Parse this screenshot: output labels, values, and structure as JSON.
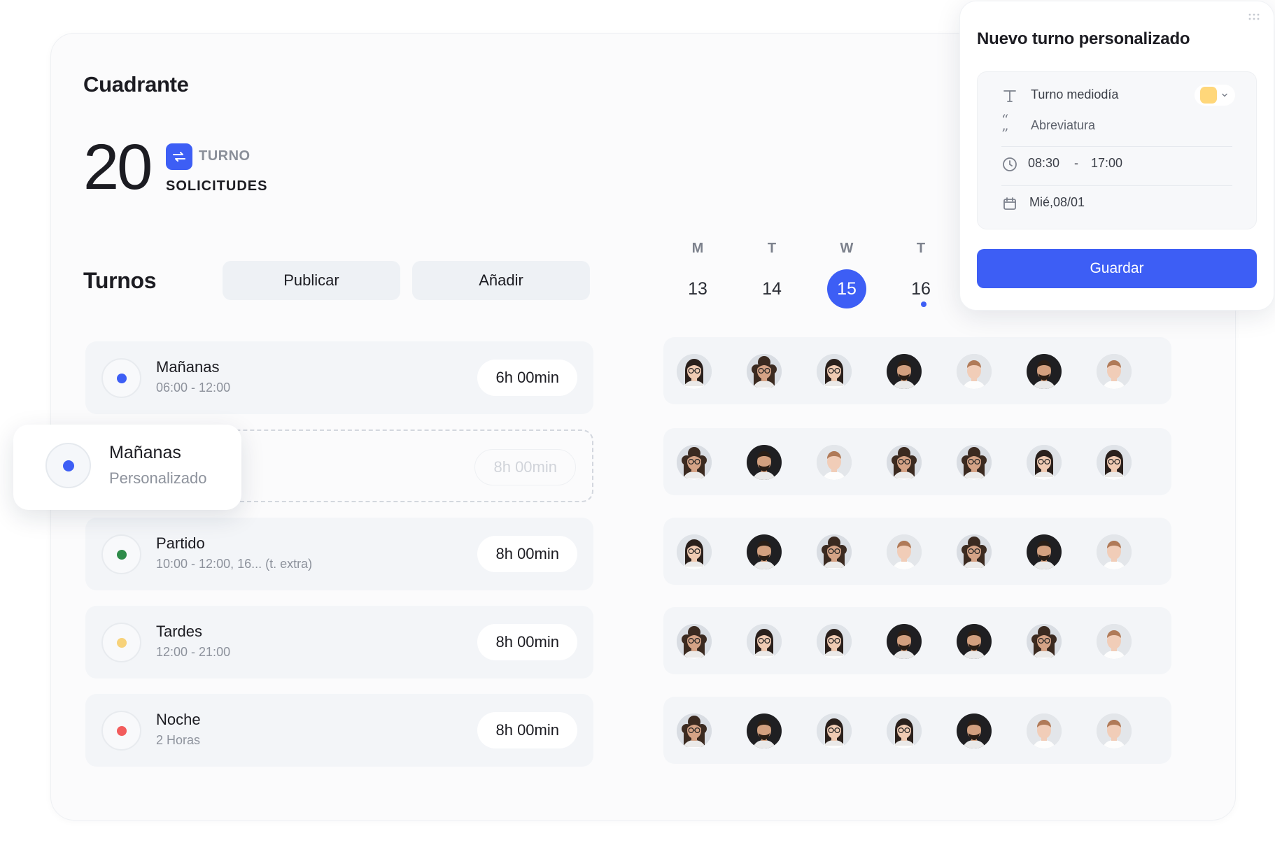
{
  "header": {
    "title": "Cuadrante",
    "requests_count": "20",
    "requests_type": "TURNO",
    "requests_label": "SOLICITUDES"
  },
  "shifts_section": {
    "title": "Turnos",
    "publish_label": "Publicar",
    "add_label": "Añadir"
  },
  "calendar": {
    "days": [
      {
        "letter": "M",
        "number": "13"
      },
      {
        "letter": "T",
        "number": "14"
      },
      {
        "letter": "W",
        "number": "15",
        "selected": true
      },
      {
        "letter": "T",
        "number": "16",
        "has_event": true
      }
    ]
  },
  "shifts": [
    {
      "name": "Mañanas",
      "time": "06:00 - 12:00",
      "duration": "6h 00min",
      "color": "#3d5ef5"
    },
    {
      "name": "",
      "time": "",
      "duration": "8h 00min",
      "color": "",
      "placeholder": true
    },
    {
      "name": "Partido",
      "time": "10:00 - 12:00, 16... (t. extra)",
      "duration": "8h 00min",
      "color": "#2e8b4a"
    },
    {
      "name": "Tardes",
      "time": "12:00 - 21:00",
      "duration": "8h 00min",
      "color": "#f7d27a"
    },
    {
      "name": "Noche",
      "time": "2 Horas",
      "duration": "8h 00min",
      "color": "#f25c5c"
    }
  ],
  "dragged_item": {
    "name": "Mañanas",
    "subtitle": "Personalizado",
    "color": "#3d5ef5"
  },
  "avatar_rows": [
    [
      "avatar-woman-glasses",
      "avatar-woman-curly",
      "avatar-woman-glasses",
      "avatar-man-beard",
      "avatar-man-light",
      "avatar-man-beard",
      "avatar-man-light"
    ],
    [
      "avatar-woman-curly",
      "avatar-man-beard",
      "avatar-man-light",
      "avatar-woman-curly",
      "avatar-woman-curly",
      "avatar-woman-glasses",
      "avatar-woman-glasses"
    ],
    [
      "avatar-woman-glasses",
      "avatar-man-beard",
      "avatar-woman-curly",
      "avatar-man-light",
      "avatar-woman-curly",
      "avatar-man-beard",
      "avatar-man-light"
    ],
    [
      "avatar-woman-curly",
      "avatar-woman-glasses",
      "avatar-woman-glasses",
      "avatar-man-beard",
      "avatar-man-beard",
      "avatar-woman-curly",
      "avatar-man-light"
    ],
    [
      "avatar-woman-curly",
      "avatar-man-beard",
      "avatar-woman-glasses",
      "avatar-woman-glasses",
      "avatar-man-beard",
      "avatar-man-light",
      "avatar-man-light"
    ]
  ],
  "new_shift_panel": {
    "title": "Nuevo turno personalizado",
    "name_value": "Turno mediodía",
    "abbreviation_placeholder": "Abreviatura",
    "time_start": "08:30",
    "time_separator": "-",
    "time_end": "17:00",
    "date_value": "Mié,08/01",
    "selected_color": "#ffd77a",
    "save_label": "Guardar"
  },
  "colors": {
    "accent": "#3d5ef5",
    "row_background": "#f3f5f8",
    "muted_text": "#8d929c"
  }
}
